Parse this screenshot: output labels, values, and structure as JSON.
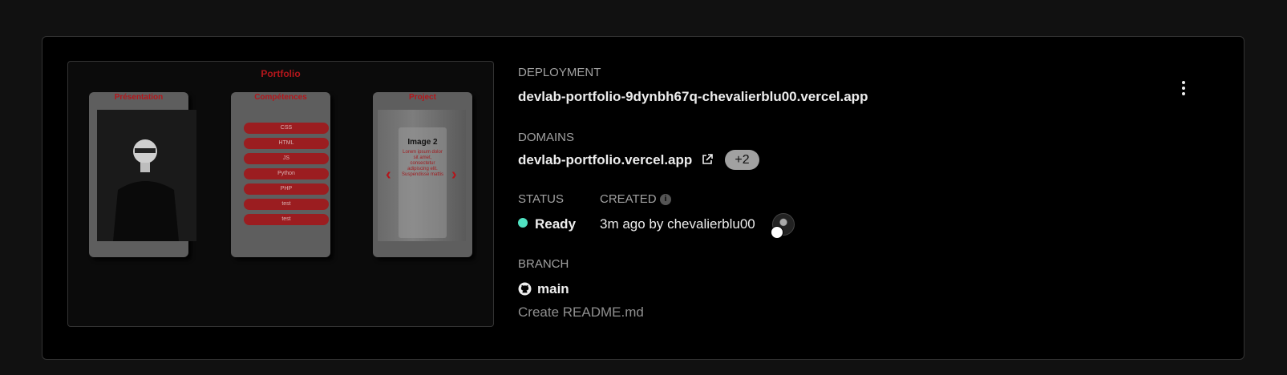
{
  "preview": {
    "title": "Portfolio",
    "cards": [
      {
        "title": "Présentation"
      },
      {
        "title": "Compétences",
        "skills": [
          "CSS",
          "HTML",
          "JS",
          "Python",
          "PHP",
          "test",
          "test"
        ]
      },
      {
        "title": "Project",
        "slide_title": "Image 2",
        "slide_text": "Lorem ipsum dolor sit amet, consectetur adipiscing elit. Suspendisse mattis"
      }
    ],
    "arrow_left": "‹",
    "arrow_right": "›"
  },
  "deployment": {
    "label": "DEPLOYMENT",
    "url": "devlab-portfolio-9dynbh67q-chevalierblu00.vercel.app"
  },
  "domains": {
    "label": "DOMAINS",
    "primary": "devlab-portfolio.vercel.app",
    "extra": "+2"
  },
  "status": {
    "label": "STATUS",
    "value": "Ready",
    "color": "#50e3c2"
  },
  "created": {
    "label": "CREATED",
    "value": "3m ago by chevalierblu00",
    "info_icon": "i"
  },
  "branch": {
    "label": "BRANCH",
    "name": "main",
    "commit": "Create README.md"
  }
}
